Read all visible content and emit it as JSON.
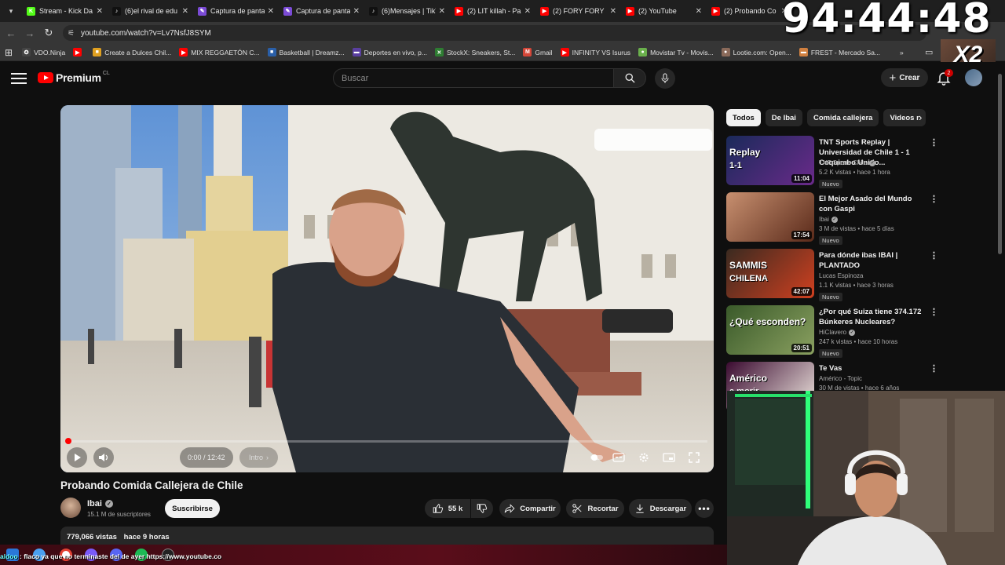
{
  "browser": {
    "tabs": [
      {
        "title": "Stream - Kick Da",
        "color": "#53fc18",
        "glyph": "K"
      },
      {
        "title": "(6)el rival de edu",
        "color": "#111111",
        "glyph": "♪"
      },
      {
        "title": "Captura de panta",
        "color": "#7b4bd6",
        "glyph": "✎"
      },
      {
        "title": "Captura de panta",
        "color": "#7b4bd6",
        "glyph": "✎"
      },
      {
        "title": "(6)Mensajes | TikT",
        "color": "#111111",
        "glyph": "♪"
      },
      {
        "title": "(2) LIT killah - Pa",
        "color": "#ff0000",
        "glyph": "▶"
      },
      {
        "title": "(2) FORY FORY ",
        "color": "#ff0000",
        "glyph": "▶"
      },
      {
        "title": "(2) YouTube",
        "color": "#ff0000",
        "glyph": "▶"
      },
      {
        "title": "(2) Probando Co",
        "color": "#ff0000",
        "glyph": "▶"
      }
    ],
    "url": "youtube.com/watch?v=Lv7NsfJ8SYM",
    "bookmarks": [
      {
        "label": "VDO.Ninja",
        "color": "#444444",
        "glyph": "✪"
      },
      {
        "label": "",
        "color": "#ff0000",
        "glyph": "▶"
      },
      {
        "label": "Create a Dulces Chil...",
        "color": "#e0a020",
        "glyph": "■"
      },
      {
        "label": "MIX REGGAETÓN C...",
        "color": "#ff0000",
        "glyph": "▶"
      },
      {
        "label": "Basketball | Dreamz...",
        "color": "#2a5fa8",
        "glyph": "■"
      },
      {
        "label": "Deportes en vivo, p...",
        "color": "#5a3fa0",
        "glyph": "▬"
      },
      {
        "label": "StockX: Sneakers, St...",
        "color": "#2e7d32",
        "glyph": "✕"
      },
      {
        "label": "Gmail",
        "color": "#d44638",
        "glyph": "M"
      },
      {
        "label": "INFINITY VS Isurus",
        "color": "#ff0000",
        "glyph": "▶"
      },
      {
        "label": "Movistar Tv - Movis...",
        "color": "#6ab04c",
        "glyph": "●"
      },
      {
        "label": "Lootie.com: Open...",
        "color": "#8a6a5a",
        "glyph": "●"
      },
      {
        "label": "FREST - Mercado Sa...",
        "color": "#d08040",
        "glyph": "▬"
      }
    ],
    "overflow": "»"
  },
  "overlay": {
    "timer": "94:44:48",
    "multiplier": "X2"
  },
  "youtube": {
    "logo_text": "Premium",
    "country": "CL",
    "search_placeholder": "Buscar",
    "create_label": "Crear",
    "notif_count": "2",
    "video": {
      "title": "Probando Comida Callejera de Chile",
      "time": "0:00 / 12:42",
      "chapter": "Intro",
      "progress_fraction": 0.003,
      "channel": "Ibai",
      "subscribers": "15.1 M de suscriptores",
      "subscribe_label": "Suscribirse",
      "likes": "55 k",
      "share_label": "Compartir",
      "clip_label": "Recortar",
      "download_label": "Descargar",
      "views": "779,066 vistas",
      "ago": "hace 9 horas"
    },
    "chips": [
      "Todos",
      "De Ibai",
      "Comida callejera",
      "Videos r"
    ],
    "recommendations": [
      {
        "title": "TNT Sports Replay | Universidad de Chile 1 - 1 Coquimbo Unido...",
        "channel": "TNT Sports Chile",
        "verified": true,
        "meta": "5.2 K vistas • hace 1 hora",
        "duration": "11:04",
        "new": "Nuevo",
        "thumb_a": "#1a2a5a",
        "thumb_b": "#6a2a8a",
        "thumb_text": "Replay",
        "thumb_sub": "1-1"
      },
      {
        "title": "El Mejor Asado del Mundo con Gaspi",
        "channel": "Ibai",
        "verified": true,
        "meta": "3 M de vistas • hace 5 días",
        "duration": "17:54",
        "new": "Nuevo",
        "thumb_a": "#c89070",
        "thumb_b": "#5a2a1a",
        "thumb_text": "",
        "thumb_sub": ""
      },
      {
        "title": "Para dónde ibas IBAI | PLANTADO",
        "channel": "Lucas Espinoza",
        "verified": false,
        "meta": "1.1 K vistas • hace 3 horas",
        "duration": "42:07",
        "new": "Nuevo",
        "thumb_a": "#3a2a20",
        "thumb_b": "#d04020",
        "thumb_text": "SAMMIS",
        "thumb_sub": "CHILENA"
      },
      {
        "title": "¿Por qué Suiza tiene 374.172 Búnkeres Nucleares?",
        "channel": "HiClavero",
        "verified": true,
        "meta": "247 k vistas • hace 10 horas",
        "duration": "20:51",
        "new": "Nuevo",
        "thumb_a": "#3a5a2a",
        "thumb_b": "#8aa060",
        "thumb_text": "¿Qué esconden?",
        "thumb_sub": ""
      },
      {
        "title": "Te Vas",
        "channel": "Américo - Topic",
        "verified": false,
        "meta": "30 M de vistas • hace 6 años",
        "duration": "",
        "new": "",
        "thumb_a": "#3a0a30",
        "thumb_b": "#f0e8e0",
        "thumb_text": "Américo",
        "thumb_sub": "a morir"
      }
    ]
  },
  "ticker": {
    "user": "aldoo",
    "message": " : flaco ya que no terminaste del de ayer https://www.youtube.co"
  }
}
